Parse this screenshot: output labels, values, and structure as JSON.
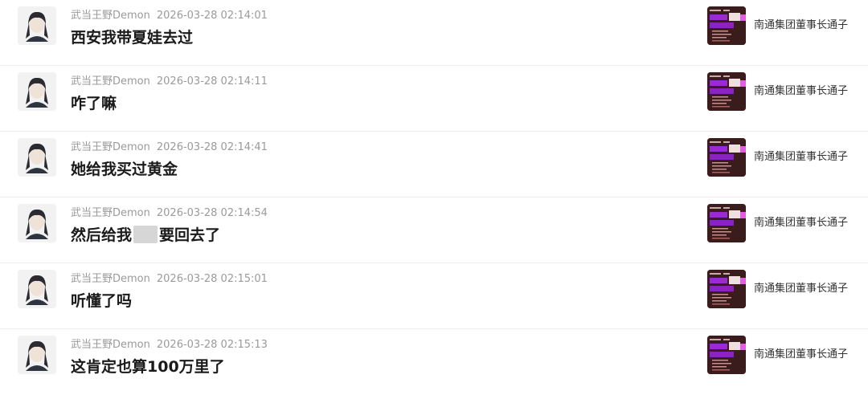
{
  "comments": [
    {
      "user": "武当王野Demon",
      "time": "2026-03-28 02:14:01",
      "text_before": "西安我带夏娃去过",
      "text_after": "",
      "redacted": false,
      "target": "南通集团董事长通子"
    },
    {
      "user": "武当王野Demon",
      "time": "2026-03-28 02:14:11",
      "text_before": "咋了嘛",
      "text_after": "",
      "redacted": false,
      "target": "南通集团董事长通子"
    },
    {
      "user": "武当王野Demon",
      "time": "2026-03-28 02:14:41",
      "text_before": "她给我买过黄金",
      "text_after": "",
      "redacted": false,
      "target": "南通集团董事长通子"
    },
    {
      "user": "武当王野Demon",
      "time": "2026-03-28 02:14:54",
      "text_before": "然后给我",
      "text_after": "要回去了",
      "redacted": true,
      "target": "南通集团董事长通子"
    },
    {
      "user": "武当王野Demon",
      "time": "2026-03-28 02:15:01",
      "text_before": "听懂了吗",
      "text_after": "",
      "redacted": false,
      "target": "南通集团董事长通子"
    },
    {
      "user": "武当王野Demon",
      "time": "2026-03-28 02:15:13",
      "text_before": "这肯定也算100万里了",
      "text_after": "",
      "redacted": false,
      "target": "南通集团董事长通子"
    }
  ],
  "colors": {
    "accent_purple": "#9b2ad6",
    "thumb_bg": "#3a1c1c"
  }
}
